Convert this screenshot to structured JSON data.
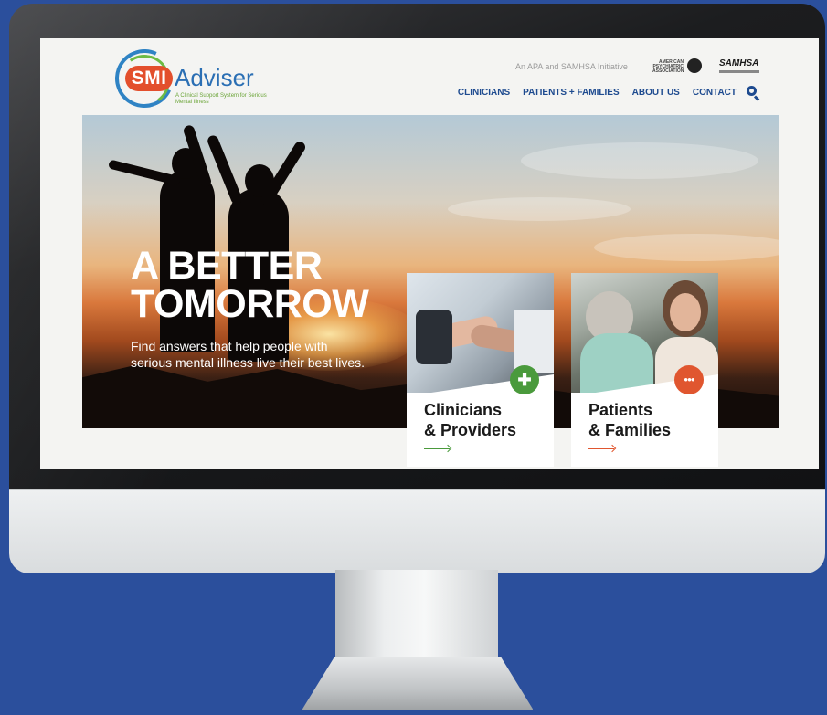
{
  "site": {
    "logo": {
      "brand_a": "SMI",
      "brand_b": "Adviser",
      "tagline": "A Clinical Support System for Serious Mental Illness"
    },
    "initiative": "An APA and SAMHSA Initiative",
    "partner_logos": {
      "apa": "AMERICAN PSYCHIATRIC ASSOCIATION",
      "samhsa": "SAMHSA"
    },
    "nav": [
      {
        "label": "CLINICIANS"
      },
      {
        "label": "PATIENTS + FAMILIES"
      },
      {
        "label": "ABOUT US"
      },
      {
        "label": "CONTACT"
      }
    ],
    "search_icon": "search-icon"
  },
  "hero": {
    "title_line1": "A BETTER",
    "title_line2": "TOMORROW",
    "subtitle": "Find answers that help people with serious mental illness live their best lives."
  },
  "cards": [
    {
      "title_line1": "Clinicians",
      "title_line2": "& Providers",
      "badge_icon": "plus-icon",
      "badge_glyph": "✚",
      "accent": "#4a9a3c"
    },
    {
      "title_line1": "Patients",
      "title_line2": "& Families",
      "badge_icon": "people-icon",
      "badge_glyph": "●●●",
      "accent": "#e0562f"
    }
  ],
  "colors": {
    "background": "#2b4f9c",
    "nav": "#1d4a8f",
    "logo_orange": "#e34f2c",
    "logo_blue": "#2b6fb4",
    "logo_green": "#6aa437"
  }
}
